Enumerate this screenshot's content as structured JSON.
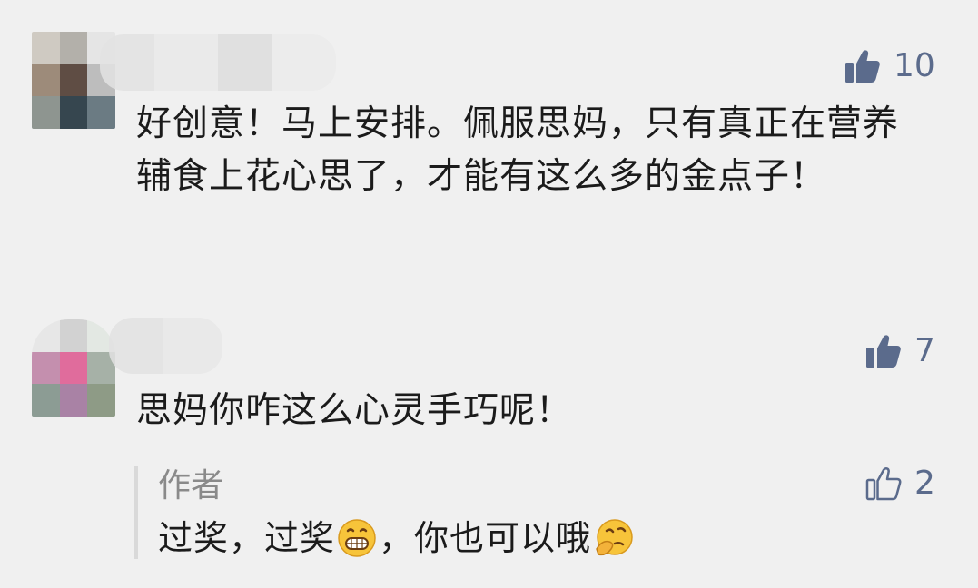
{
  "comments": [
    {
      "like_count": "10",
      "text": "好创意！马上安排。佩服思妈，只有真正在营养辅食上花心思了，才能有这么多的金点子！"
    },
    {
      "like_count": "7",
      "text": "思妈你咋这么心灵手巧呢！",
      "reply": {
        "author": "作者",
        "text_part1": "过奖，过奖",
        "text_part2": "，你也可以哦",
        "emoji1": "grinning-face-emoji",
        "emoji2": "thinking-face-emoji",
        "like_count": "2"
      }
    }
  ],
  "colors": {
    "background": "#f0f0f0",
    "like_blue": "#5b6b8c",
    "text": "#1b1b1b",
    "author_gray": "#8a8a8a"
  },
  "icons": {
    "like_filled": "thumbs-up-filled-icon",
    "like_outline": "thumbs-up-outline-icon"
  }
}
